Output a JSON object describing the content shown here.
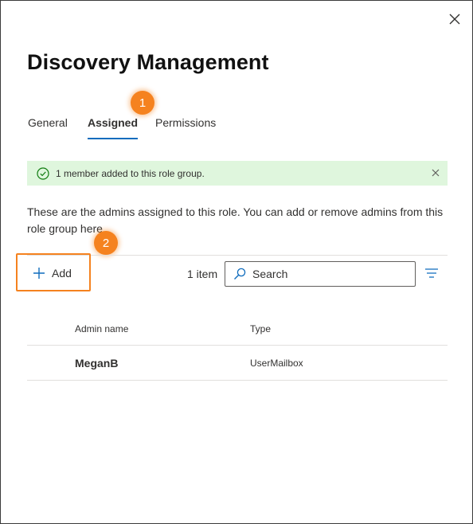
{
  "panel": {
    "title": "Discovery Management",
    "close_icon": "close-icon"
  },
  "tabs": [
    {
      "label": "General",
      "active": false
    },
    {
      "label": "Assigned",
      "active": true
    },
    {
      "label": "Permissions",
      "active": false
    }
  ],
  "callouts": [
    "1",
    "2"
  ],
  "banner": {
    "message": "1 member added to this role group.",
    "icon": "success-check-icon",
    "color": "#dff6dd"
  },
  "description": "These are the admins assigned to this role. You can add or remove admins from this role group here.",
  "toolbar": {
    "add_label": "Add",
    "item_count": "1 item",
    "search_placeholder": "Search"
  },
  "table": {
    "columns": [
      "Admin name",
      "Type"
    ],
    "rows": [
      {
        "admin_name": "MeganB",
        "type": "UserMailbox"
      }
    ]
  },
  "colors": {
    "accent": "#0f6cbd",
    "callout": "#f5821f",
    "success_bg": "#dff6dd"
  }
}
